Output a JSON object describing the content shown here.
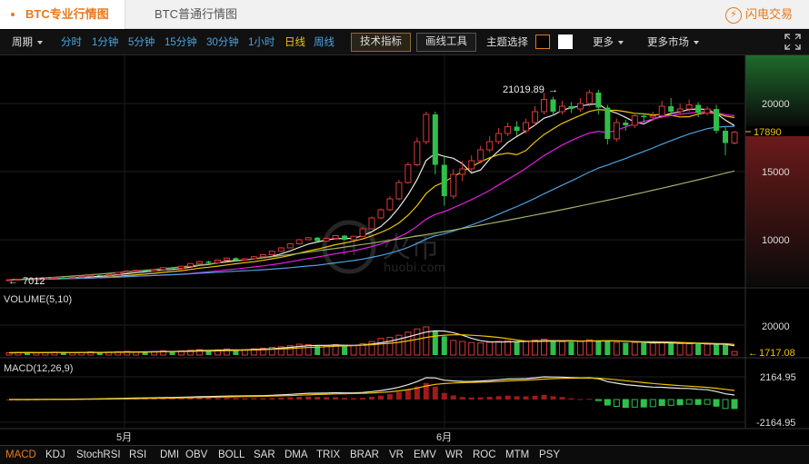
{
  "tabs": {
    "pro": "BTC专业行情图",
    "normal": "BTC普通行情图",
    "flash": "闪电交易"
  },
  "toolbar": {
    "period": "周期",
    "intervals": [
      "分时",
      "1分钟",
      "5分钟",
      "15分钟",
      "30分钟",
      "1小时",
      "日线",
      "周线"
    ],
    "active_interval": "日线",
    "tech_button": "技术指标",
    "draw_button": "画线工具",
    "theme_label": "主题选择",
    "more": "更多",
    "more_markets": "更多市场"
  },
  "main_chart": {
    "y_ticks": [
      "20000",
      "15000",
      "10000"
    ],
    "last_price": "17890",
    "high_label": "21019.89",
    "low_label": "7012",
    "x_labels": [
      "5月",
      "6月"
    ],
    "watermark_text": "火币",
    "watermark_sub": "huobi.com"
  },
  "volume": {
    "title": "VOLUME(5,10)",
    "tick": "20000",
    "last": "1717.08"
  },
  "macd": {
    "title": "MACD(12,26,9)",
    "tick_pos": "2164.95",
    "tick_neg": "-2164.95"
  },
  "indicators": [
    "MACD",
    "KDJ",
    "StochRSI",
    "RSI",
    "DMI",
    "OBV",
    "BOLL",
    "SAR",
    "DMA",
    "TRIX",
    "BRAR",
    "VR",
    "EMV",
    "WR",
    "ROC",
    "MTM",
    "PSY"
  ],
  "active_indicator": "MACD",
  "colors": {
    "up": "#d83a3a",
    "down": "#2fbf4a",
    "accent": "#e8791b",
    "ma5": "#e8e8e8",
    "ma10": "#f0c400",
    "ma30": "#e21ee0",
    "ma60": "#4aa3df",
    "ma120": "#9db06a"
  },
  "chart_data": {
    "type": "candlestick",
    "interval": "daily",
    "x_labels": [
      "5月",
      "6月"
    ],
    "price_ylim": [
      5500,
      22500
    ],
    "candles": [
      [
        7010,
        7060,
        7000,
        7080
      ],
      [
        7060,
        7100,
        7040,
        7120
      ],
      [
        7100,
        7080,
        7050,
        7140
      ],
      [
        7080,
        7120,
        7060,
        7150
      ],
      [
        7120,
        7180,
        7100,
        7200
      ],
      [
        7180,
        7220,
        7160,
        7250
      ],
      [
        7220,
        7200,
        7170,
        7260
      ],
      [
        7200,
        7250,
        7180,
        7280
      ],
      [
        7250,
        7320,
        7230,
        7350
      ],
      [
        7320,
        7400,
        7300,
        7440
      ],
      [
        7400,
        7380,
        7350,
        7430
      ],
      [
        7380,
        7460,
        7360,
        7500
      ],
      [
        7460,
        7600,
        7440,
        7650
      ],
      [
        7600,
        7700,
        7580,
        7760
      ],
      [
        7700,
        7750,
        7660,
        7800
      ],
      [
        7750,
        7700,
        7650,
        7820
      ],
      [
        7700,
        7800,
        7680,
        7850
      ],
      [
        7800,
        7950,
        7780,
        8000
      ],
      [
        7950,
        7900,
        7850,
        8010
      ],
      [
        7900,
        8050,
        7880,
        8100
      ],
      [
        8050,
        8250,
        8030,
        8300
      ],
      [
        8250,
        8400,
        8220,
        8450
      ],
      [
        8400,
        8300,
        8250,
        8460
      ],
      [
        8300,
        8500,
        8280,
        8550
      ],
      [
        8500,
        8650,
        8480,
        8700
      ],
      [
        8650,
        8500,
        8450,
        8700
      ],
      [
        8500,
        8600,
        8470,
        8660
      ],
      [
        8600,
        8750,
        8580,
        8800
      ],
      [
        8750,
        8900,
        8720,
        8950
      ],
      [
        8900,
        9150,
        8880,
        9200
      ],
      [
        9150,
        9400,
        9120,
        9450
      ],
      [
        9400,
        9700,
        9380,
        9750
      ],
      [
        9700,
        10000,
        9650,
        10050
      ],
      [
        10000,
        10150,
        9950,
        10200
      ],
      [
        10150,
        9900,
        9850,
        10200
      ],
      [
        9900,
        10100,
        9880,
        10150
      ],
      [
        10100,
        10300,
        10050,
        10350
      ],
      [
        10300,
        10000,
        9950,
        10350
      ],
      [
        10000,
        10250,
        9980,
        10300
      ],
      [
        10250,
        10800,
        10200,
        10900
      ],
      [
        10800,
        11600,
        10750,
        11700
      ],
      [
        11600,
        12200,
        11500,
        12300
      ],
      [
        12200,
        13000,
        12100,
        13200
      ],
      [
        13000,
        14200,
        12900,
        14400
      ],
      [
        14200,
        15500,
        14100,
        15700
      ],
      [
        15500,
        17200,
        15400,
        17500
      ],
      [
        17200,
        19200,
        17000,
        19400
      ],
      [
        19200,
        15500,
        14800,
        19400
      ],
      [
        15500,
        13200,
        12500,
        16200
      ],
      [
        13200,
        14800,
        13000,
        15200
      ],
      [
        14800,
        15200,
        14300,
        15800
      ],
      [
        15200,
        15800,
        15000,
        16200
      ],
      [
        15800,
        16600,
        15600,
        16900
      ],
      [
        16600,
        17200,
        16400,
        17600
      ],
      [
        17200,
        17800,
        17000,
        18200
      ],
      [
        17800,
        18300,
        17600,
        18600
      ],
      [
        18300,
        18000,
        17600,
        18700
      ],
      [
        18000,
        18600,
        17800,
        18900
      ],
      [
        18600,
        19400,
        18400,
        19800
      ],
      [
        19400,
        20300,
        19200,
        20800
      ],
      [
        20300,
        19400,
        19100,
        20500
      ],
      [
        19400,
        19800,
        19200,
        20200
      ],
      [
        19800,
        19600,
        19300,
        20100
      ],
      [
        19600,
        20000,
        19400,
        20400
      ],
      [
        20000,
        20800,
        19800,
        21020
      ],
      [
        20800,
        19700,
        19200,
        21000
      ],
      [
        19700,
        17400,
        17000,
        19900
      ],
      [
        17400,
        18600,
        17200,
        18900
      ],
      [
        18600,
        18400,
        18000,
        18800
      ],
      [
        18400,
        19100,
        18200,
        19300
      ],
      [
        19100,
        19000,
        18600,
        19300
      ],
      [
        19000,
        19100,
        18700,
        19400
      ],
      [
        19100,
        19800,
        18900,
        20200
      ],
      [
        19800,
        19400,
        19100,
        20400
      ],
      [
        19400,
        19600,
        19200,
        20000
      ],
      [
        19600,
        19900,
        19400,
        20300
      ],
      [
        19900,
        19300,
        19000,
        20100
      ],
      [
        19300,
        19600,
        19100,
        19800
      ],
      [
        19600,
        18000,
        17800,
        19900
      ],
      [
        18000,
        17100,
        16200,
        18300
      ],
      [
        17100,
        17890,
        17000,
        18000
      ]
    ],
    "volume": [
      1100,
      1200,
      1300,
      1000,
      1200,
      1400,
      1200,
      1100,
      1300,
      1500,
      1200,
      1400,
      1600,
      1800,
      1400,
      1500,
      1700,
      2100,
      1800,
      2000,
      2300,
      2600,
      2100,
      2500,
      2900,
      2400,
      2600,
      3000,
      3300,
      3700,
      4000,
      4500,
      5200,
      5000,
      4300,
      4400,
      5000,
      4800,
      4600,
      5500,
      6500,
      8000,
      8500,
      9500,
      11000,
      12500,
      13500,
      11500,
      9000,
      7000,
      6500,
      6000,
      5800,
      6200,
      6600,
      7000,
      6300,
      6500,
      7200,
      7600,
      6800,
      6400,
      6300,
      6500,
      7300,
      7000,
      6800,
      6100,
      5900,
      6000,
      5800,
      5700,
      6000,
      5600,
      5500,
      5400,
      5300,
      5200,
      5000,
      4900,
      1717
    ],
    "volume_ylim": [
      0,
      27000
    ],
    "volume_last": 1717.08,
    "macd": {
      "ylim": [
        -2164.95,
        2164.95
      ],
      "dif_peak": 2164.95
    },
    "moving_averages": [
      "MA5",
      "MA10",
      "MA30",
      "MA60",
      "MA120"
    ],
    "last_price": 17890,
    "high": 21019.89,
    "low": 7012
  }
}
